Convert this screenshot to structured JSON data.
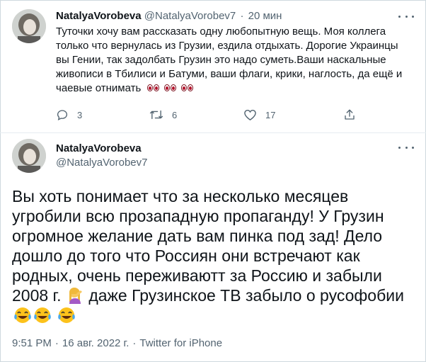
{
  "reply": {
    "display_name": "NatalyaVorobeva",
    "handle": "@NatalyaVorobev7",
    "separator": "·",
    "time": "20 мин",
    "text": "Туточки хочу вам рассказать одну любопытную вещь. Моя коллега только что вернулась из Грузии, ездила отдыхать. Дорогие Украинцы вы Гении, так задолбать Грузин это надо суметь.Ваши наскальные живописи в Тбилиси и Батуми, ваши флаги, крики, наглость, да ещё и чаевые отнимать",
    "emoji": "👀👀👀",
    "actions": {
      "reply_count": "3",
      "retweet_count": "6",
      "like_count": "17"
    }
  },
  "main": {
    "display_name": "NatalyaVorobeva",
    "handle": "@NatalyaVorobev7",
    "text_1": "Вы хоть понимает что за несколько месяцев угробили всю прозападную пропаганду! У Грузин огромное желание дать вам пинка под зад! Дело дошло до того что Россиян они встречают как родных, очень переживаютт за Россию и забыли 2008 г.",
    "text_2": "даже Грузинское ТВ забыло о русофобии",
    "time": "9:51 PM",
    "date": "16 авг. 2022 г.",
    "source": "Twitter for iPhone",
    "meta_separator": "·"
  },
  "colors": {
    "text": "#0f1419",
    "secondary": "#536471",
    "border": "#cfd9de"
  },
  "icons": [
    "reply-icon",
    "retweet-icon",
    "like-icon",
    "share-icon",
    "more-icon",
    "woman-facepalm-emoji",
    "tears-of-joy-emoji",
    "eyes-emoji"
  ]
}
